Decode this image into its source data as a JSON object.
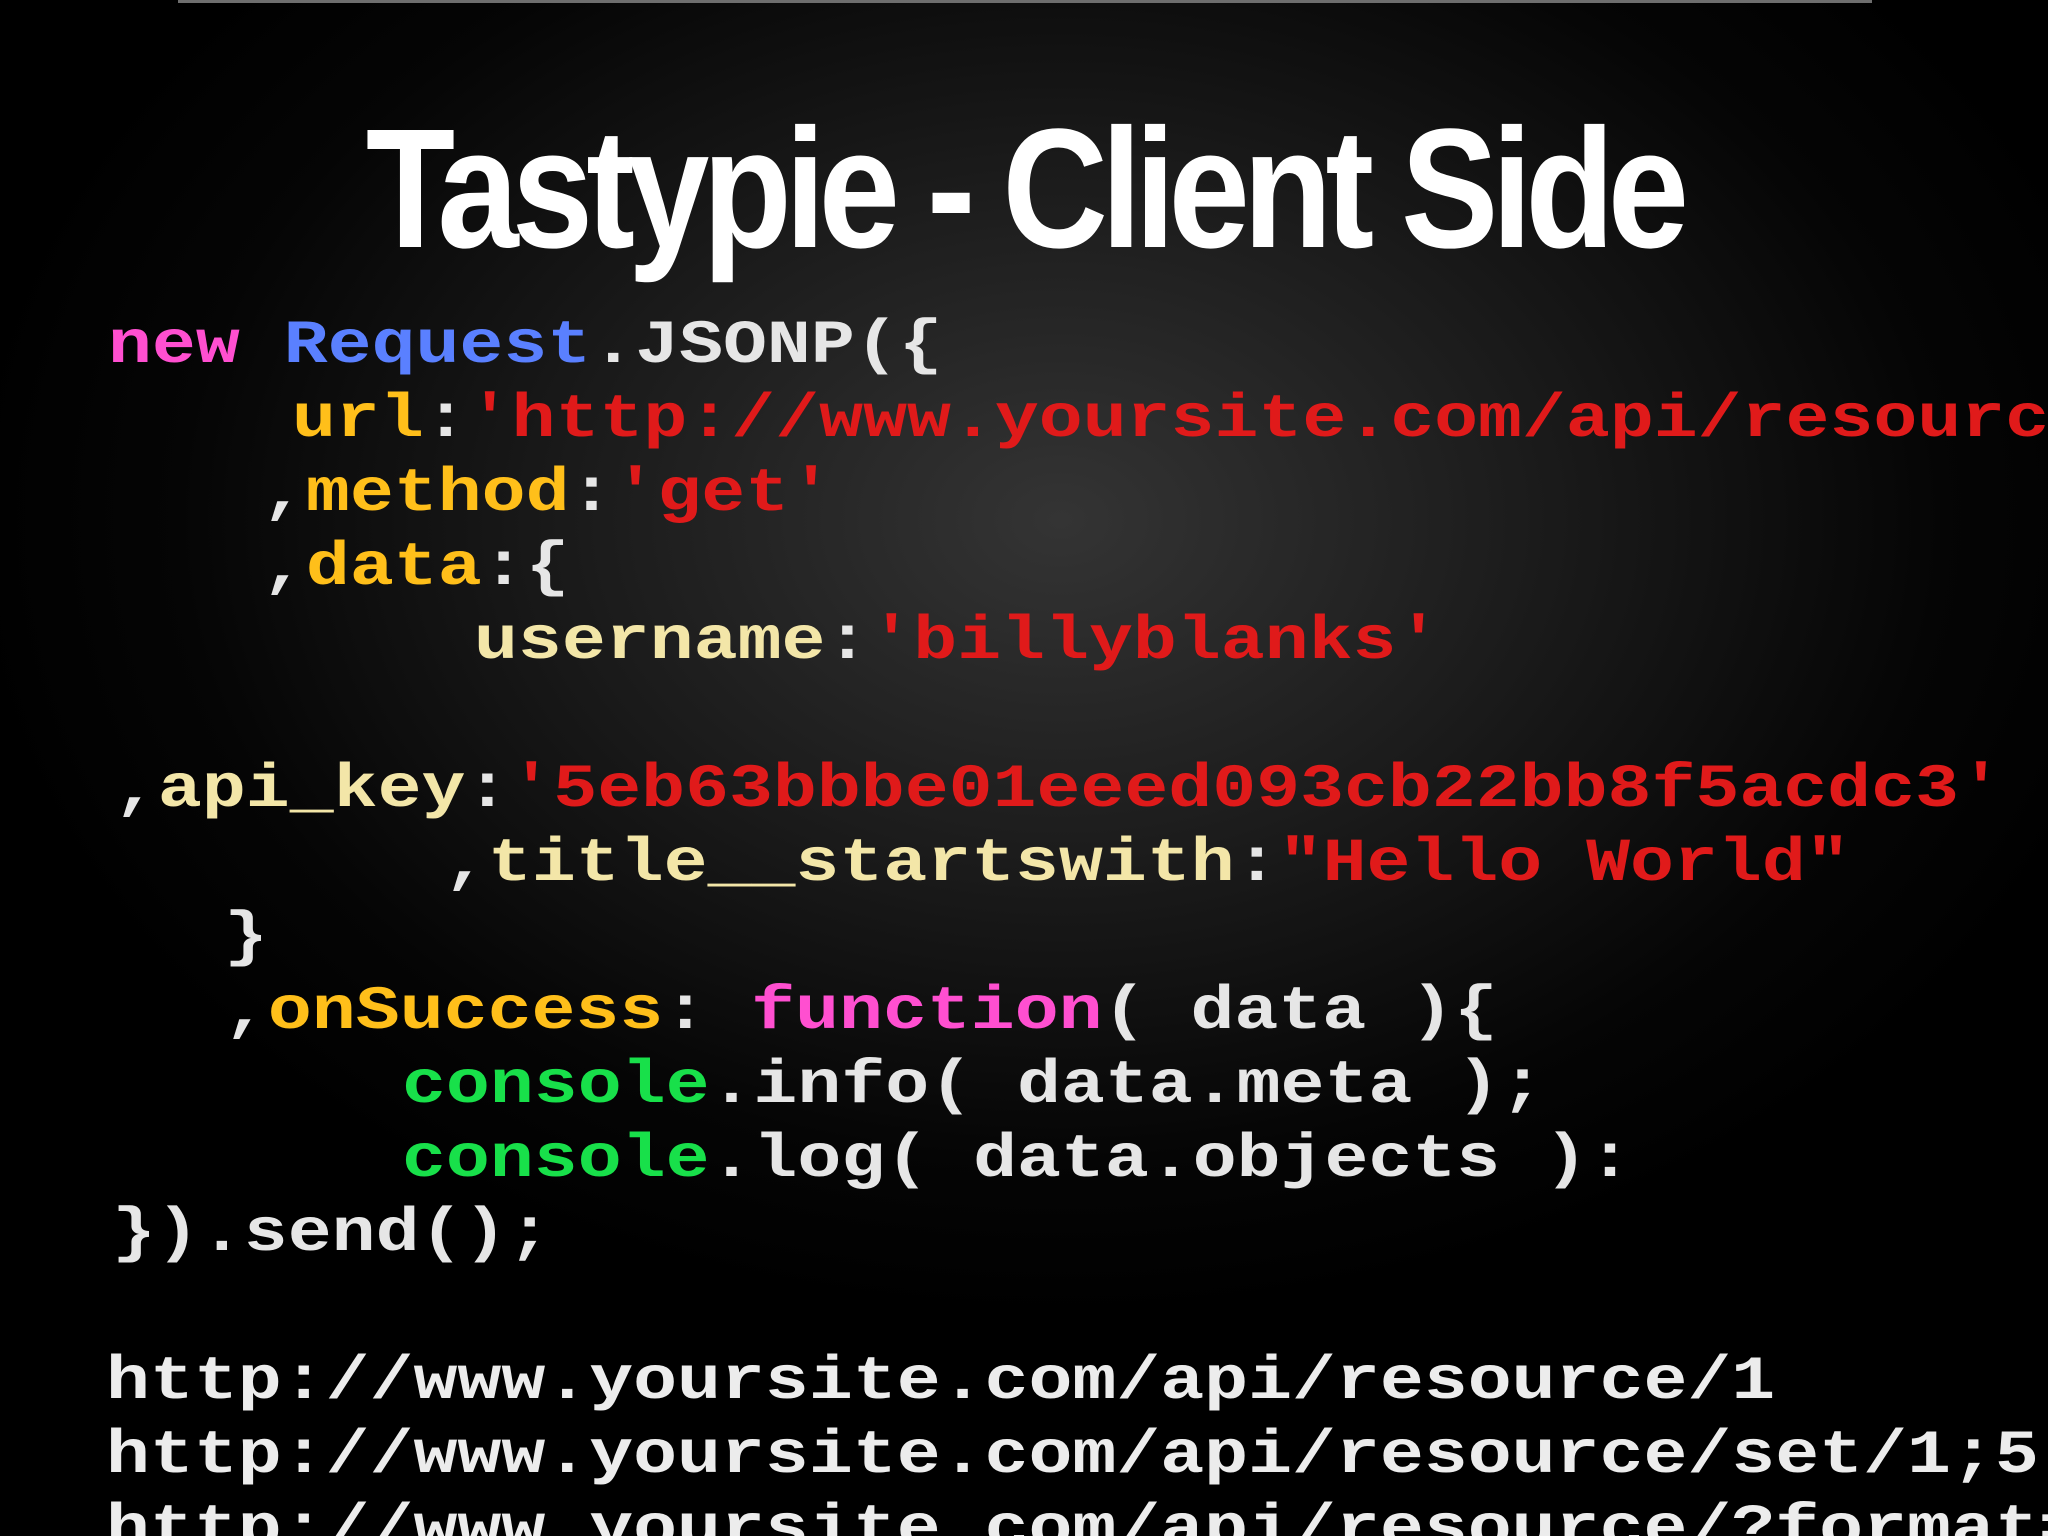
{
  "slide": {
    "title": "Tastypie - Client Side"
  },
  "code": {
    "line1": {
      "kw": "new",
      "cls": "Request",
      "rest": ".JSONP({"
    },
    "line2": {
      "prop": "url",
      "colon": ":",
      "str": "'http://www.yoursite.com/api/resource'"
    },
    "line3": {
      "comma": ",",
      "prop": "method",
      "colon": ":",
      "str": "'get'"
    },
    "line4": {
      "comma": ",",
      "prop": "data",
      "rest": ":{"
    },
    "line5": {
      "key": "username",
      "colon": ":",
      "str": "'billyblanks'"
    },
    "line6": {
      "comma": ",",
      "key": "api_key",
      "colon": ":",
      "str": "'5eb63bbbe01eeed093cb22bb8f5acdc3'"
    },
    "line7": {
      "comma": ",",
      "key": "title__startswith",
      "colon": ":",
      "str": "\"Hello World\""
    },
    "line8": {
      "rest": "}"
    },
    "line9": {
      "comma": ",",
      "prop": "onSuccess",
      "colon": ": ",
      "kw": "function",
      "rest": "( data ){"
    },
    "line10": {
      "con": "console",
      "rest": ".info( data.meta );"
    },
    "line11": {
      "con": "console",
      "rest": ".log( data.objects ):"
    },
    "line12": {
      "rest": "}).send();"
    }
  },
  "urls": [
    "http://www.yoursite.com/api/resource/1",
    "http://www.yoursite.com/api/resource/set/1;5",
    "http://www.yoursite.com/api/resource/?format=xml"
  ],
  "colors": {
    "keyword": "#ff4fd0",
    "class": "#5a80ff",
    "property": "#ffbf1a",
    "key": "#f3e6a8",
    "string": "#e01a1a",
    "console": "#18e04a",
    "text": "#e6e6e6"
  }
}
